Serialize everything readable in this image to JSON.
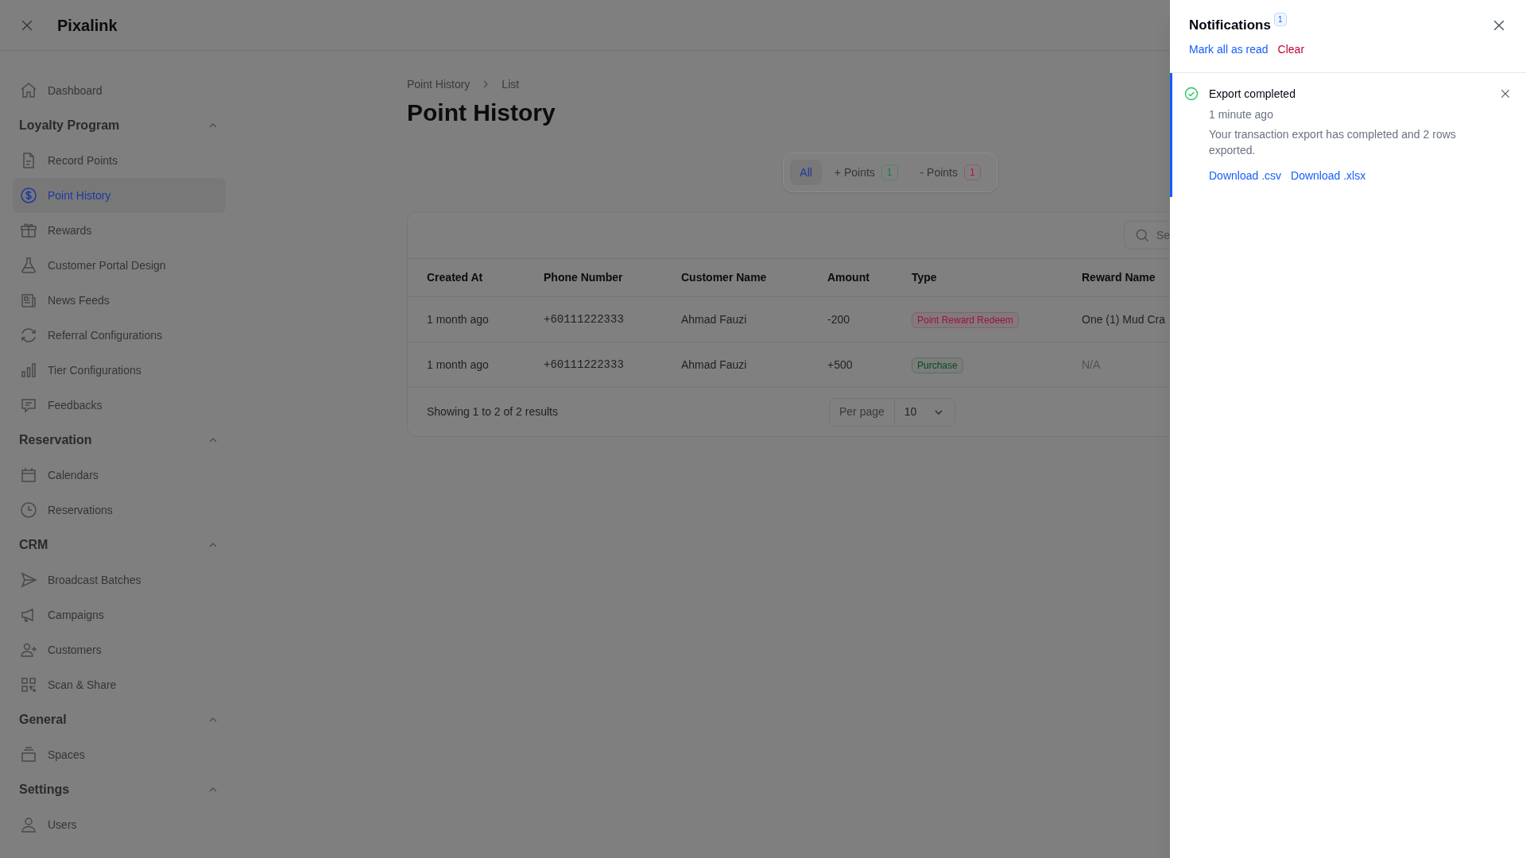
{
  "app": {
    "title": "Pixalink"
  },
  "sidebar": [
    {
      "kind": "link",
      "label": "Dashboard",
      "selected": false
    },
    {
      "kind": "section",
      "label": "Loyalty Program",
      "expanded": true,
      "children": [
        {
          "kind": "link",
          "label": "Record Points",
          "selected": false
        },
        {
          "kind": "link",
          "label": "Point History",
          "selected": true
        },
        {
          "kind": "link",
          "label": "Rewards",
          "selected": false
        },
        {
          "kind": "link",
          "label": "Customer Portal Design",
          "selected": false
        },
        {
          "kind": "link",
          "label": "News Feeds",
          "selected": false
        },
        {
          "kind": "link",
          "label": "Referral Configurations",
          "selected": false
        },
        {
          "kind": "link",
          "label": "Tier Configurations",
          "selected": false
        },
        {
          "kind": "link",
          "label": "Feedbacks",
          "selected": false
        }
      ]
    },
    {
      "kind": "section",
      "label": "Reservation",
      "expanded": true,
      "children": [
        {
          "kind": "link",
          "label": "Calendars",
          "selected": false
        },
        {
          "kind": "link",
          "label": "Reservations",
          "selected": false
        }
      ]
    },
    {
      "kind": "section",
      "label": "CRM",
      "expanded": true,
      "children": [
        {
          "kind": "link",
          "label": "Broadcast Batches",
          "selected": false
        },
        {
          "kind": "link",
          "label": "Campaigns",
          "selected": false
        },
        {
          "kind": "link",
          "label": "Customers",
          "selected": false
        },
        {
          "kind": "link",
          "label": "Scan & Share",
          "selected": false
        }
      ]
    },
    {
      "kind": "section",
      "label": "General",
      "expanded": true,
      "children": [
        {
          "kind": "link",
          "label": "Spaces",
          "selected": false
        }
      ]
    },
    {
      "kind": "section",
      "label": "Settings",
      "expanded": true,
      "children": [
        {
          "kind": "link",
          "label": "Users",
          "selected": false
        }
      ]
    }
  ],
  "main": {
    "breadcrumbs": [
      "Point History",
      "List"
    ],
    "title": "Point History",
    "filter_tabs": [
      {
        "label": "All",
        "selected": true
      },
      {
        "label": "+ Points",
        "count": "1",
        "color": "#15803d",
        "selected": false
      },
      {
        "label": "- Points",
        "count": "1",
        "color": "#be123c",
        "selected": false
      }
    ],
    "search": {
      "placeholder": "Se"
    },
    "table": {
      "columns": [
        "Created At",
        "Phone Number",
        "Customer Name",
        "Amount",
        "Type",
        "Reward Name"
      ],
      "rows": [
        {
          "created_at": "1 month ago",
          "phone": "+60111222333",
          "customer": "Ahmad Fauzi",
          "amount": "-200",
          "type": {
            "text": "Point Reward Redeem",
            "color": "#9f1239"
          },
          "reward": "One (1) Mud Cra",
          "reward_muted": false
        },
        {
          "created_at": "1 month ago",
          "phone": "+60111222333",
          "customer": "Ahmad Fauzi",
          "amount": "+500",
          "type": {
            "text": "Purchase",
            "color": "#0d4a1f"
          },
          "reward": "N/A",
          "reward_muted": true
        }
      ]
    },
    "footer": {
      "summary": "Showing 1 to 2 of 2 results",
      "per_page_label": "Per page",
      "per_page": "10"
    }
  },
  "notifications": {
    "title": "Notifications",
    "count": "1",
    "mark_all": "Mark all as read",
    "clear": "Clear",
    "items": [
      {
        "kind": "success",
        "unread": true,
        "title": "Export completed",
        "time": "1 minute ago",
        "body": "Your transaction export has completed and 2 rows exported.",
        "links": [
          "Download .csv",
          "Download .xlsx"
        ]
      }
    ]
  }
}
